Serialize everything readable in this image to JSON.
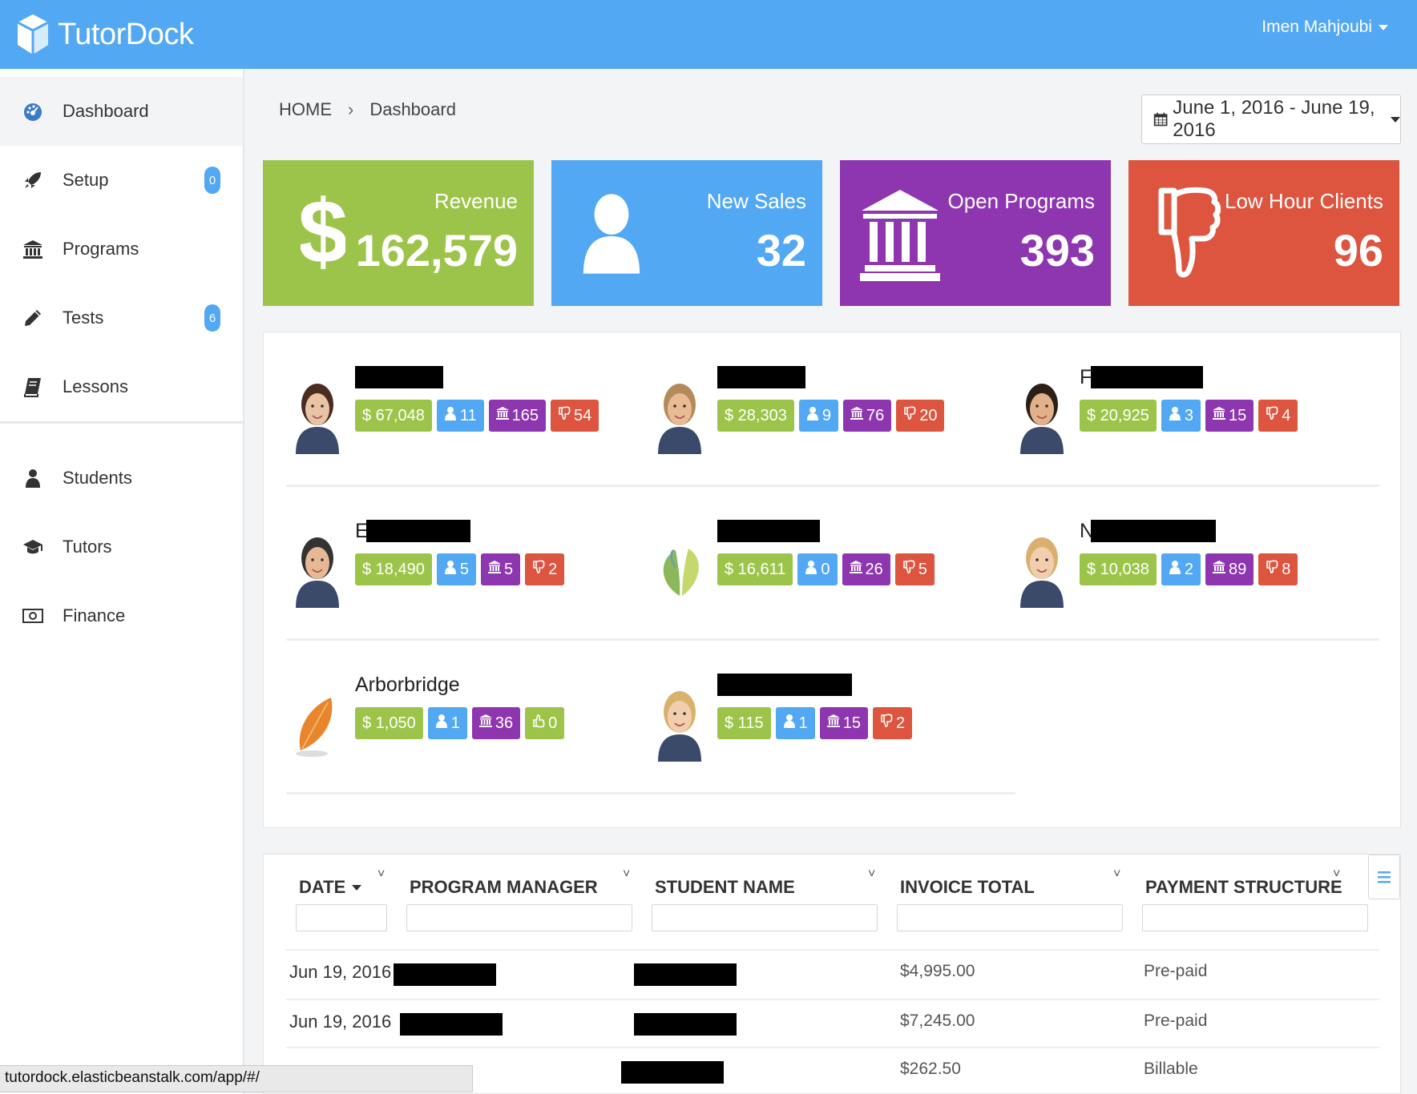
{
  "app": {
    "name": "TutorDock",
    "user": "Imen Mahjoubi"
  },
  "sidebar": {
    "items": [
      {
        "label": "Dashboard",
        "icon": "dashboard-icon",
        "badge": null
      },
      {
        "label": "Setup",
        "icon": "rocket-icon",
        "badge": "0"
      },
      {
        "label": "Programs",
        "icon": "bank-icon",
        "badge": null
      },
      {
        "label": "Tests",
        "icon": "pencil-icon",
        "badge": "6"
      },
      {
        "label": "Lessons",
        "icon": "book-icon",
        "badge": null
      },
      {
        "label": "Students",
        "icon": "user-icon",
        "badge": null
      },
      {
        "label": "Tutors",
        "icon": "graduation-cap-icon",
        "badge": null
      },
      {
        "label": "Finance",
        "icon": "money-icon",
        "badge": null
      }
    ]
  },
  "breadcrumb": {
    "home": "HOME",
    "current": "Dashboard"
  },
  "date_range": "June 1, 2016 - June 19, 2016",
  "stats": [
    {
      "label": "Revenue",
      "value": "162,579",
      "icon": "dollar-icon",
      "color": "#9dc44a"
    },
    {
      "label": "New Sales",
      "value": "32",
      "icon": "user-icon",
      "color": "#52a8f2"
    },
    {
      "label": "Open Programs",
      "value": "393",
      "icon": "bank-icon",
      "color": "#8e36b0"
    },
    {
      "label": "Low Hour Clients",
      "value": "96",
      "icon": "thumbs-down-icon",
      "color": "#dd543f"
    }
  ],
  "members": [
    {
      "name": "",
      "revenue": "$ 67,048",
      "students": "11",
      "programs": "165",
      "low": "54",
      "low_type": "thumbs-down"
    },
    {
      "name": "",
      "revenue": "$ 28,303",
      "students": "9",
      "programs": "76",
      "low": "20",
      "low_type": "thumbs-down"
    },
    {
      "name": "F",
      "revenue": "$ 20,925",
      "students": "3",
      "programs": "15",
      "low": "4",
      "low_type": "thumbs-down"
    },
    {
      "name": "E",
      "revenue": "$ 18,490",
      "students": "5",
      "programs": "5",
      "low": "2",
      "low_type": "thumbs-down"
    },
    {
      "name": "",
      "revenue": "$ 16,611",
      "students": "0",
      "programs": "26",
      "low": "5",
      "low_type": "thumbs-down"
    },
    {
      "name": "N",
      "revenue": "$ 10,038",
      "students": "2",
      "programs": "89",
      "low": "8",
      "low_type": "thumbs-down"
    },
    {
      "name": "Arborbridge",
      "revenue": "$ 1,050",
      "students": "1",
      "programs": "36",
      "low": "0",
      "low_type": "thumbs-up"
    },
    {
      "name": "",
      "revenue": "$ 115",
      "students": "1",
      "programs": "15",
      "low": "2",
      "low_type": "thumbs-down"
    }
  ],
  "table": {
    "columns": [
      "DATE",
      "PROGRAM MANAGER",
      "STUDENT NAME",
      "INVOICE TOTAL",
      "PAYMENT STRUCTURE"
    ],
    "rows": [
      {
        "date": "Jun 19, 2016",
        "total": "$4,995.00",
        "payment": "Pre-paid"
      },
      {
        "date": "Jun 19, 2016",
        "total": "$7,245.00",
        "payment": "Pre-paid"
      },
      {
        "date": "",
        "total": "$262.50",
        "payment": "Billable"
      }
    ]
  },
  "status_url": "tutordock.elasticbeanstalk.com/app/#/"
}
